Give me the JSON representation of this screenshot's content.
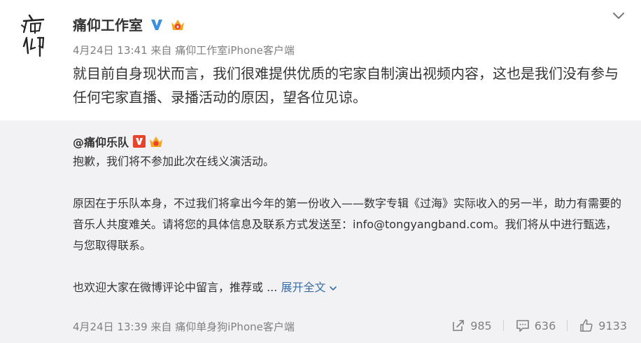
{
  "post": {
    "author": "痛仰工作室",
    "timestamp": "4月24日 13:41",
    "source_prefix": "来自",
    "source": "痛仰工作室iPhone客户端",
    "text": "就目前自身现状而言，我们很难提供优质的宅家自制演出视频内容，这也是我们没有参与任何宅家直播、录播活动的原因，望各位见谅。",
    "avatar_icon": "calligraphy-avatar",
    "verified_icon": "verified-v-icon",
    "member_icon": "member-crown-icon",
    "menu_icon": "chevron-down-icon"
  },
  "repost": {
    "author": "@痛仰乐队",
    "paragraph1": "抱歉，我们将不参加此次在线义演活动。",
    "paragraph2": "原因在于乐队本身，不过我们将拿出今年的第一份收入——数字专辑《过海》实际收入的另一半，助力有需要的音乐人共度难关。请将您的具体信息及联系方式发送至：info@tongyangband.com。我们将从中进行甄选，与您取得联系。",
    "paragraph3_prefix": "也欢迎大家在微博评论中留言，推荐或 ...",
    "expand_label": "展开全文",
    "timestamp": "4月24日 13:39",
    "source_prefix": "来自",
    "source": "痛仰单身狗iPhone客户端",
    "reposts": "985",
    "comments": "636",
    "likes": "9133",
    "colors": {
      "background": "#f2f2f5",
      "link": "#3a6ea5",
      "meta": "#808080"
    }
  }
}
